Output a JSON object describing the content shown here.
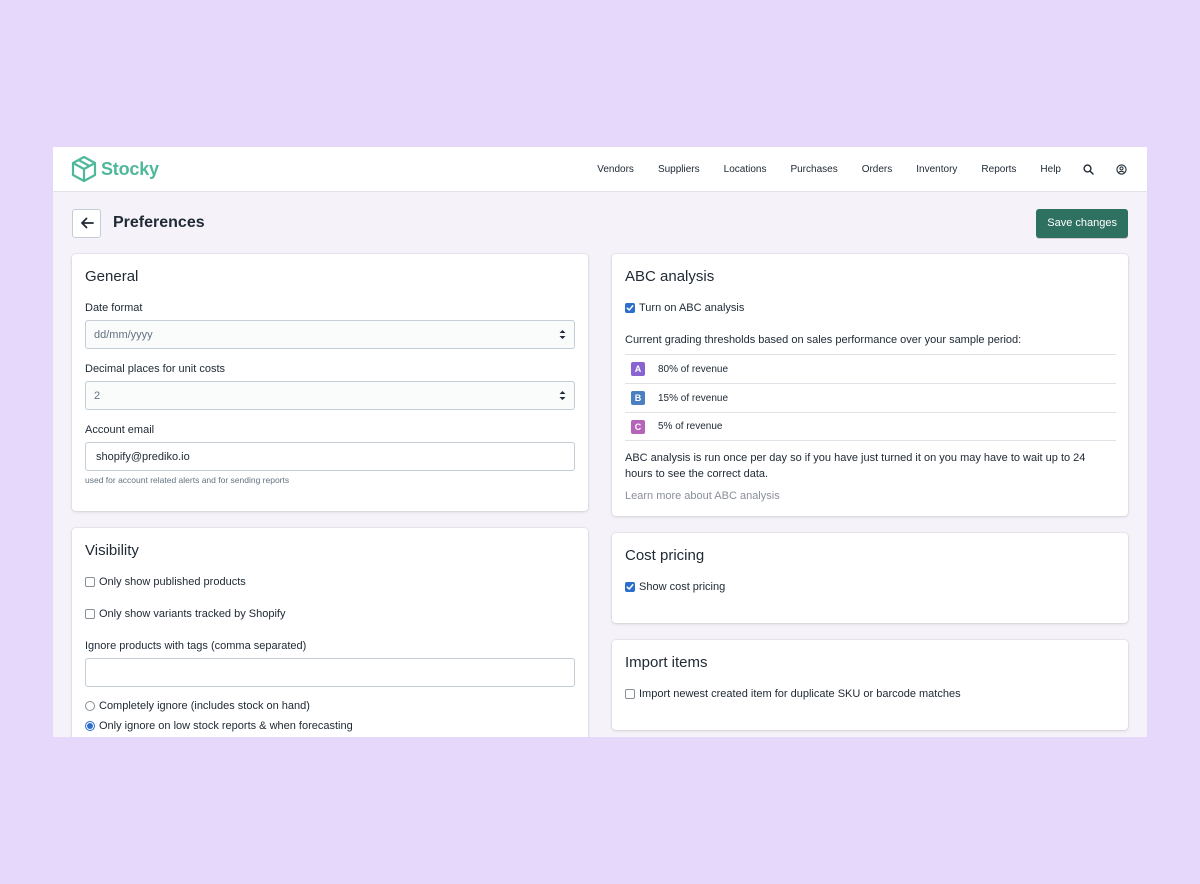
{
  "app": {
    "name": "Stocky"
  },
  "nav": {
    "items": [
      "Vendors",
      "Suppliers",
      "Locations",
      "Purchases",
      "Orders",
      "Inventory",
      "Reports",
      "Help"
    ],
    "icons": [
      "search-icon",
      "user-icon"
    ]
  },
  "page": {
    "title": "Preferences",
    "save_label": "Save changes"
  },
  "general": {
    "title": "General",
    "date_format": {
      "label": "Date format",
      "value": "dd/mm/yyyy"
    },
    "decimal_places": {
      "label": "Decimal places for unit costs",
      "value": "2"
    },
    "email": {
      "label": "Account email",
      "value": "shopify@prediko.io",
      "help": "used for account related alerts and for sending reports"
    }
  },
  "visibility": {
    "title": "Visibility",
    "published_only": {
      "label": "Only show published products",
      "checked": false
    },
    "shopify_variants": {
      "label": "Only show variants tracked by Shopify",
      "checked": false
    },
    "ignore_tags": {
      "label": "Ignore products with tags (comma separated)",
      "value": ""
    },
    "ignore_mode": {
      "options": [
        "Completely ignore (includes stock on hand)",
        "Only ignore on low stock reports & when forecasting"
      ],
      "selected": 1
    }
  },
  "abc": {
    "title": "ABC analysis",
    "toggle": {
      "label": "Turn on ABC analysis",
      "checked": true
    },
    "description": "Current grading thresholds based on sales performance over your sample period:",
    "grades": [
      {
        "letter": "A",
        "text": "80% of revenue",
        "color": "#8a63d2"
      },
      {
        "letter": "B",
        "text": "15% of revenue",
        "color": "#4a7fc1"
      },
      {
        "letter": "C",
        "text": "5% of revenue",
        "color": "#b564b8"
      }
    ],
    "note": "ABC analysis is run once per day so if you have just turned it on you may have to wait up to 24 hours to see the correct data.",
    "link": "Learn more about ABC analysis"
  },
  "cost_pricing": {
    "title": "Cost pricing",
    "toggle": {
      "label": "Show cost pricing",
      "checked": true
    }
  },
  "import_items": {
    "title": "Import items",
    "toggle": {
      "label": "Import newest created item for duplicate SKU or barcode matches",
      "checked": false
    }
  },
  "colors": {
    "background": "#e6d8fb",
    "brand": "#4fb89a",
    "primary_button": "#2f7160",
    "checkbox": "#2c6ecb"
  }
}
